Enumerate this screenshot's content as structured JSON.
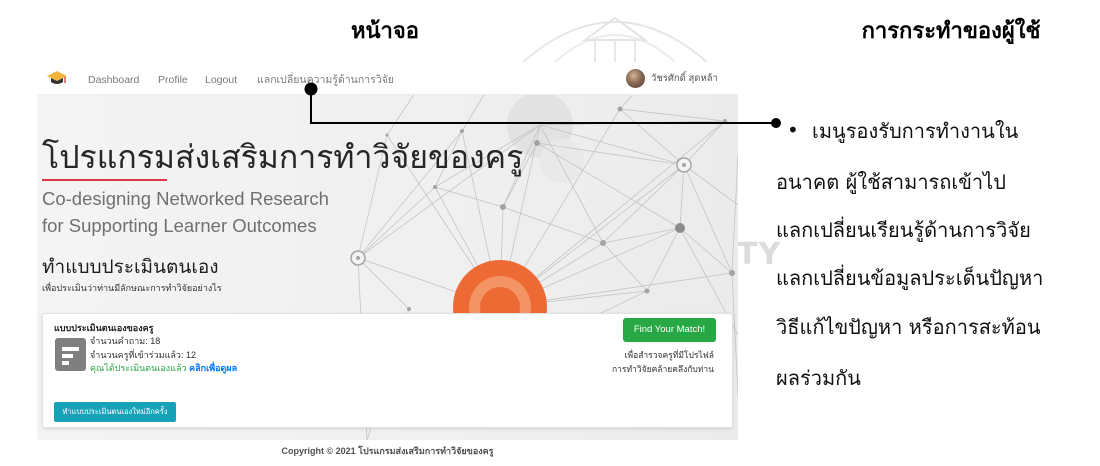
{
  "figure": {
    "left_heading": "หน้าจอ",
    "right_heading": "การกระทำของผู้ใช้",
    "watermark_text": "TY"
  },
  "navbar": {
    "items": [
      {
        "label": "Dashboard"
      },
      {
        "label": "Profile"
      },
      {
        "label": "Logout"
      },
      {
        "label": "แลกเปลี่ยนความรู้ด้านการวิจัย"
      }
    ],
    "user_name": "วัชรศักดิ์ สุดหล้า"
  },
  "hero": {
    "title": "โปรแกรมส่งเสริมการทำวิจัยของครู",
    "subtitle_line1": "Co-designing Networked Research",
    "subtitle_line2": "for Supporting Learner Outcomes",
    "section_title": "ทำแบบประเมินตนเอง",
    "section_desc": "เพื่อประเมินว่าท่านมีลักษณะการทำวิจัยอย่างไร"
  },
  "assessment_card": {
    "title": "แบบประเมินตนเองของครู",
    "question_count": "จำนวนคำถาม: 18",
    "participant_count": "จำนวนครูที่เข้าร่วมแล้ว: 12",
    "status_text": "คุณได้ประเมินตนเองแล้ว",
    "result_link": "คลิกเพื่อดูผล",
    "match_button": "Find Your Match!",
    "match_desc_line1": "เพื่อสำรวจครูที่มีโปรไฟล์",
    "match_desc_line2": "การทำวิจัยคล้ายคลึงกับท่าน",
    "retake_button": "ทำแบบประเมินตนเองใหม่อีกครั้ง"
  },
  "footer": {
    "copyright": "Copyright © 2021 โปรแกรมส่งเสริมการทำวิจัยของครู"
  },
  "annotation": {
    "bullet": "•",
    "lines": [
      "เมนูรองรับการทำงานใน",
      "อนาคต ผู้ใช้สามารถเข้าไป",
      "แลกเปลี่ยนเรียนรู้ด้านการวิจัย",
      "แลกเปลี่ยนข้อมูลประเด็นปัญหา",
      "วิธีแก้ไขปัญหา หรือการสะท้อน",
      "ผลร่วมกัน"
    ]
  },
  "icons": {
    "logo": "graduation-cap-icon",
    "avatar": "user-avatar",
    "assessment": "form-document-icon",
    "hero_graphic": "network-graph",
    "watermark": "university-seal"
  },
  "colors": {
    "title_underline": "#dc3545",
    "match_button": "#28a745",
    "retake_button": "#17a2b8",
    "status_text": "#28a745",
    "result_link": "#007bff",
    "network_highlight": "#ee6a34",
    "callout": "#000000"
  }
}
